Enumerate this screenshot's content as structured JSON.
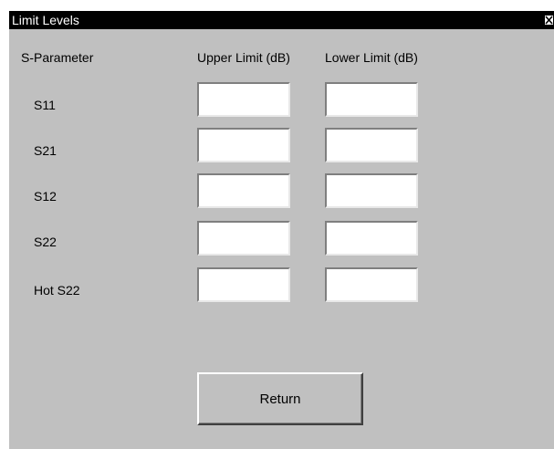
{
  "window": {
    "title": "Limit Levels",
    "close_label": "×"
  },
  "columns": {
    "parameter": "S-Parameter",
    "upper": "Upper Limit (dB)",
    "lower": "Lower Limit (dB)"
  },
  "rows": [
    {
      "label": "S11",
      "upper": "",
      "lower": ""
    },
    {
      "label": "S21",
      "upper": "",
      "lower": ""
    },
    {
      "label": "S12",
      "upper": "",
      "lower": ""
    },
    {
      "label": "S22",
      "upper": "",
      "lower": ""
    },
    {
      "label": "Hot S22",
      "upper": "",
      "lower": ""
    }
  ],
  "buttons": {
    "return_label": "Return"
  },
  "colors": {
    "dialog_bg": "#c0c0c0",
    "titlebar_bg": "#000000",
    "titlebar_text": "#ffffff",
    "field_bg": "#ffffff"
  }
}
